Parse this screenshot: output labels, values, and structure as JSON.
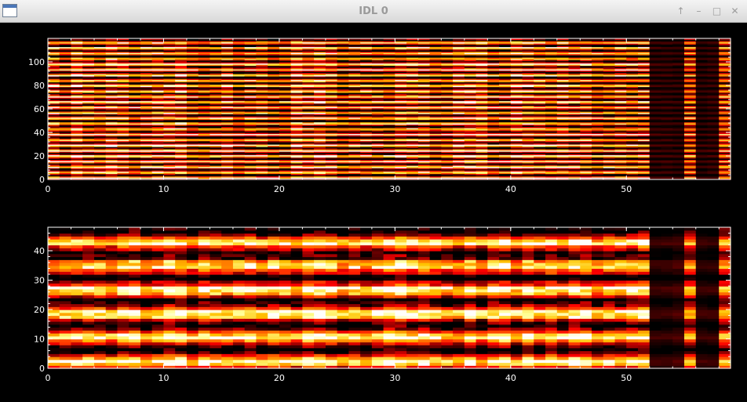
{
  "window": {
    "title": "IDL 0",
    "icons": [
      "window-icon",
      "maximize-up-icon",
      "minimize-icon",
      "restore-icon",
      "close-icon"
    ],
    "buttons": [
      "↑",
      "–",
      "□",
      "✕"
    ]
  },
  "chart_data": [
    {
      "type": "heatmap",
      "title": "",
      "xlabel": "",
      "ylabel": "",
      "xlim": [
        0,
        59
      ],
      "ylim": [
        0,
        120
      ],
      "xticks": [
        "0",
        "10",
        "20",
        "30",
        "40",
        "50"
      ],
      "yticks": [
        "0",
        "20",
        "40",
        "60",
        "80",
        "100"
      ],
      "colormap": "red-temperature",
      "stripe_period_rows": 4.6,
      "dark_columns": [
        52,
        53,
        54,
        56,
        57
      ],
      "dim_columns": [
        55,
        58
      ]
    },
    {
      "type": "heatmap",
      "title": "",
      "xlabel": "",
      "ylabel": "",
      "xlim": [
        0,
        59
      ],
      "ylim": [
        0,
        48
      ],
      "xticks": [
        "0",
        "10",
        "20",
        "30",
        "40",
        "50"
      ],
      "yticks": [
        "0",
        "10",
        "20",
        "30",
        "40"
      ],
      "colormap": "red-temperature",
      "stripe_period_rows": 8.1,
      "dark_columns": [
        52,
        53,
        54,
        56,
        57
      ],
      "dim_columns": [
        55,
        58
      ]
    }
  ]
}
